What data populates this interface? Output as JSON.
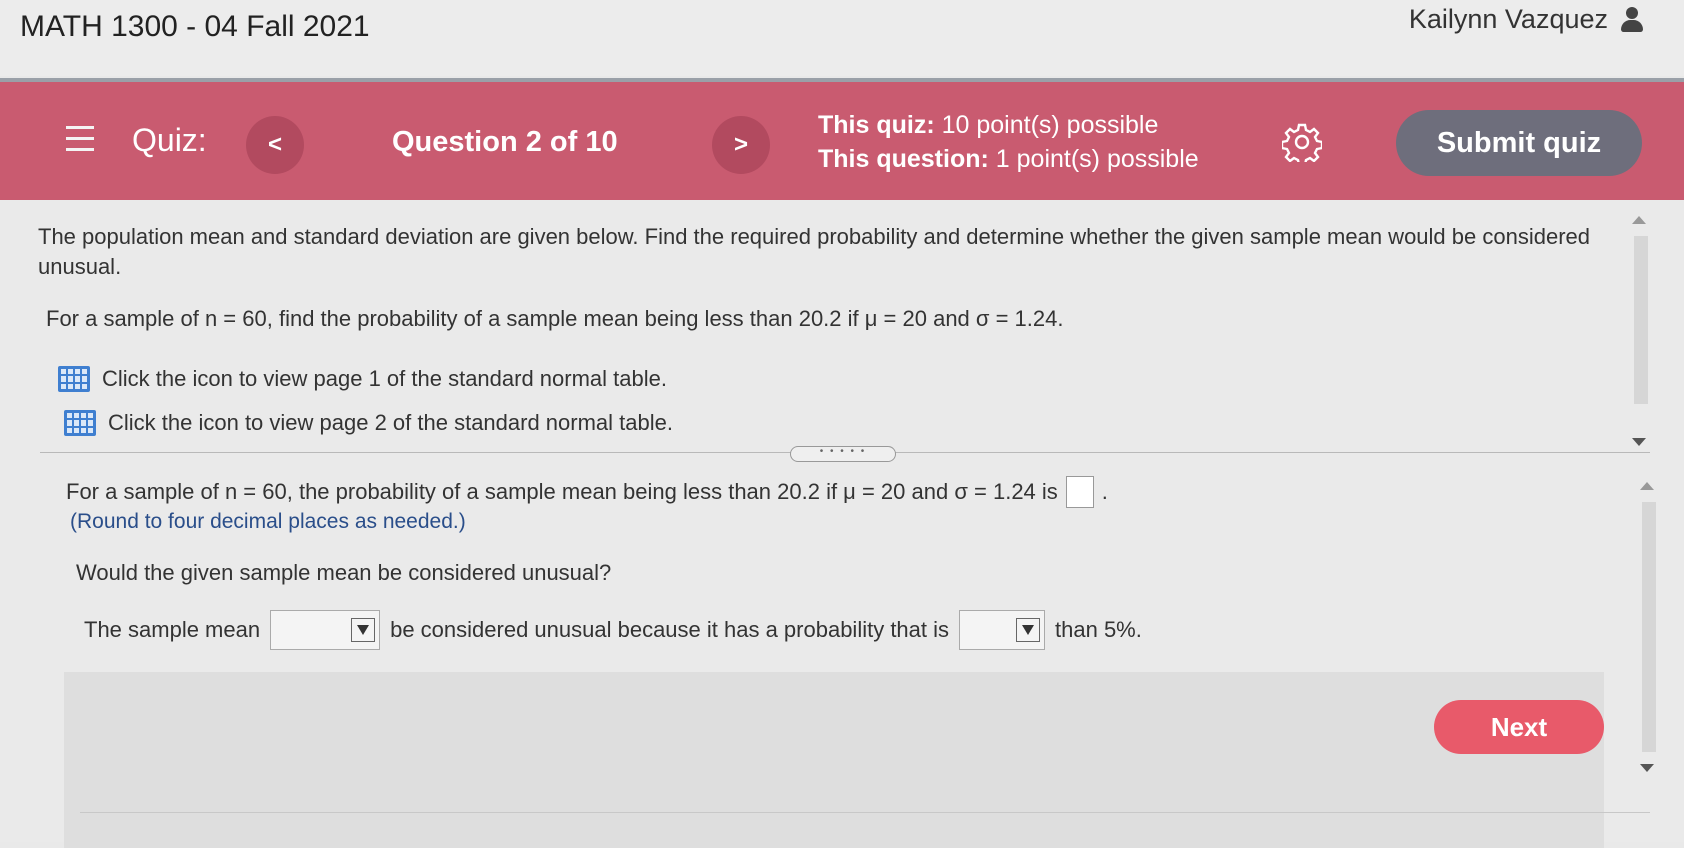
{
  "header": {
    "course_title": "MATH 1300 - 04 Fall 2021",
    "user_name": "Kailynn Vazquez"
  },
  "quizbar": {
    "quiz_label": "Quiz:",
    "prev_arrow": "<",
    "next_arrow": ">",
    "question_label": "Question 2 of 10",
    "quiz_points_bold": "This quiz:",
    "quiz_points_text": "10 point(s) possible",
    "question_points_bold": "This question:",
    "question_points_text": "1 point(s) possible",
    "submit_label": "Submit quiz",
    "colors": {
      "bar": "#c95b70",
      "submit": "#6e6e7c"
    }
  },
  "question": {
    "intro": "The population mean and standard deviation are given below. Find the required probability and determine whether the given sample mean would be considered unusual.",
    "problem": "For a sample of n = 60, find the probability of a sample mean being less than 20.2 if μ = 20 and σ = 1.24.",
    "link1": "Click the icon to view page 1 of the standard normal table.",
    "link2": "Click the icon to view page 2 of the standard normal table."
  },
  "answer": {
    "prompt": "For a sample of n = 60, the probability of a sample mean being less than 20.2 if μ = 20 and σ = 1.24 is",
    "period": ".",
    "round_note": "(Round to four decimal places as needed.)",
    "unusual_question": "Would the given sample mean be considered unusual?",
    "sentence_part1": "The sample mean",
    "sentence_part2": "be considered unusual because it has a probability that is",
    "sentence_part3": "than 5%."
  },
  "footer": {
    "next_label": "Next",
    "next_color": "#e85a6a"
  }
}
